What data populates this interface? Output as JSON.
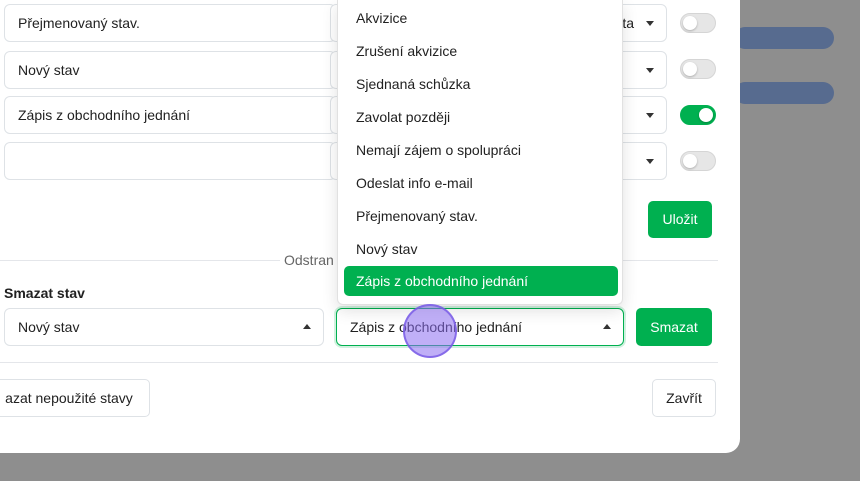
{
  "rows": [
    {
      "name": "Přejmenovaný stav.",
      "select_suffix": "sta",
      "active": false
    },
    {
      "name": "Nový stav",
      "select_suffix": "",
      "active": false
    },
    {
      "name": "Zápis z obchodního jednání",
      "select_suffix": "",
      "active": true
    },
    {
      "name": "",
      "select_suffix": "",
      "active": false
    }
  ],
  "save_label": "Uložit",
  "delete_section": {
    "title": "Odstran",
    "label": "Smazat stav",
    "source_value": "Nový stav",
    "target_value": "Zápis z obchodního jednání",
    "delete_label": "Smazat"
  },
  "footer": {
    "delete_unused_label": "azat nepoužité stavy",
    "close_label": "Zavřít"
  },
  "dropdown": {
    "options": [
      "Akvizice",
      "Zrušení akvizice",
      "Sjednaná schůzka",
      "Zavolat později",
      "Nemají zájem o spolupráci",
      "Odeslat info e-mail",
      "Přejmenovaný stav.",
      "Nový stav",
      "Zápis z obchodního jednání"
    ],
    "selected": "Zápis z obchodního jednání"
  },
  "colors": {
    "accent": "#00b050",
    "overlay": "#8e8e8e",
    "background_pill": "#2a4f8f"
  }
}
